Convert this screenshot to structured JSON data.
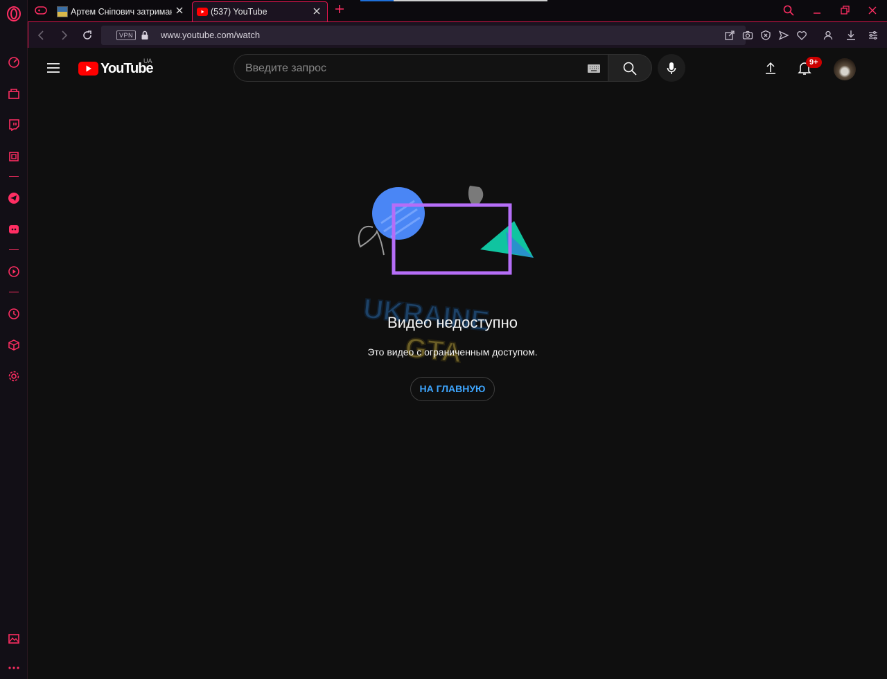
{
  "browser": {
    "tabs": [
      {
        "title": "Артем Сніпович затриман",
        "active": false
      },
      {
        "title": "(537) YouTube",
        "active": true
      }
    ],
    "address": {
      "vpn_label": "VPN",
      "url": "www.youtube.com/watch"
    },
    "accent_color": "#e0154e"
  },
  "youtube": {
    "logo_text": "YouTube",
    "country_code": "UA",
    "search_placeholder": "Введите запрос",
    "notification_badge": "9+"
  },
  "content": {
    "title": "Видео недоступно",
    "message": "Это видео с ограниченным доступом.",
    "home_button": "НА ГЛАВНУЮ",
    "home_button_color": "#3ea6ff"
  },
  "watermark": {
    "line1": "UKRAINE",
    "line2": "GTA"
  }
}
